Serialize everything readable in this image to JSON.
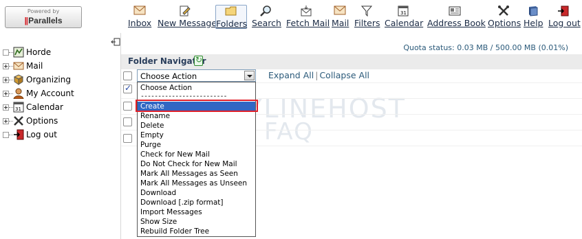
{
  "logo": {
    "powered_by": "Powered by",
    "brand": "Parallels"
  },
  "toolbar": [
    {
      "id": "inbox",
      "label": "Inbox",
      "icon": "envelope-icon"
    },
    {
      "id": "new-message",
      "label": "New Message",
      "icon": "compose-icon"
    },
    {
      "id": "folders",
      "label": "Folders",
      "icon": "folder-icon",
      "active": true
    },
    {
      "id": "search",
      "label": "Search",
      "icon": "magnifier-icon"
    },
    {
      "id": "fetch-mail",
      "label": "Fetch Mail",
      "icon": "fetch-mail-icon"
    },
    {
      "id": "mail",
      "label": "Mail",
      "icon": "mail-envelope-icon"
    },
    {
      "id": "filters",
      "label": "Filters",
      "icon": "funnel-icon"
    },
    {
      "id": "calendar",
      "label": "Calendar",
      "icon": "calendar-icon"
    },
    {
      "id": "address-book",
      "label": "Address Book",
      "icon": "address-card-icon"
    },
    {
      "id": "options",
      "label": "Options",
      "icon": "tools-icon"
    },
    {
      "id": "help",
      "label": "Help",
      "icon": "help-book-icon"
    },
    {
      "id": "log-out",
      "label": "Log out",
      "icon": "exit-door-icon"
    }
  ],
  "sidebar": {
    "items": [
      {
        "label": "Horde",
        "icon": "horde-icon"
      },
      {
        "label": "Mail",
        "icon": "mail-icon"
      },
      {
        "label": "Organizing",
        "icon": "organizing-icon"
      },
      {
        "label": "My Account",
        "icon": "user-icon"
      },
      {
        "label": "Calendar",
        "icon": "calendar-icon"
      },
      {
        "label": "Options",
        "icon": "tools-icon"
      },
      {
        "label": "Log out",
        "icon": "exit-door-icon"
      }
    ]
  },
  "quota": "Quota status: 0.03 MB / 500.00 MB (0.01%)",
  "folder_navigator": {
    "title": "Folder Navigator",
    "select_value": "Choose Action",
    "expand_all": "Expand All",
    "collapse_all": "Collapse All",
    "options": [
      "Choose Action",
      "-------------------------",
      "Create",
      "Rename",
      "Delete",
      "Empty",
      "Purge",
      "Check for New Mail",
      "Do Not Check for New Mail",
      "Mark All Messages as Seen",
      "Mark All Messages as Unseen",
      "Download",
      "Download [.zip format]",
      "Import Messages",
      "Show Size",
      "Rebuild Folder Tree"
    ],
    "highlighted_option": "Create",
    "row_checkboxes": [
      false,
      true,
      false,
      false,
      false
    ]
  },
  "watermark": {
    "line1": "EASYLINEHOST",
    "line2": "FAQ"
  },
  "colors": {
    "accent": "#3167c4",
    "highlight_border": "#e0202a",
    "link": "#2b5a7a"
  }
}
